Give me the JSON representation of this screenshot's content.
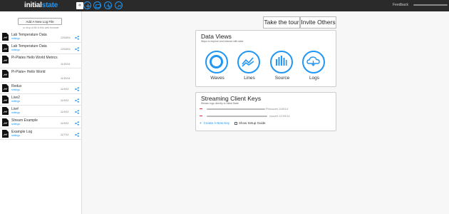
{
  "brand": {
    "initial": "initial",
    "state": "state"
  },
  "topbar": {
    "collapse_glyph": "«",
    "icons": [
      "plus-icon",
      "dashboard-icon",
      "waveform-icon",
      "tile-icon"
    ],
    "feedback_label": "Feedback"
  },
  "sidebar": {
    "add_button": "Add A New Log File",
    "drop_hint": "or drop a file in this web browser",
    "items": [
      {
        "name": "Lab Temperature Data",
        "settings": "settings",
        "date": "12/18/14"
      },
      {
        "name": "Lab Temperature Data",
        "settings": "settings",
        "date": "12/18/14"
      },
      {
        "name": "Pi-Plates Hello World Metrics",
        "settings": "",
        "date": "11/20/14"
      },
      {
        "name": "Pi-Plate+ Hello World",
        "settings": "",
        "date": "11/20/14"
      },
      {
        "name": "Redux",
        "settings": "settings",
        "date": "11/9/14"
      },
      {
        "name": "Live2",
        "settings": "settings",
        "date": "11/9/14"
      },
      {
        "name": "Live!",
        "settings": "settings",
        "date": "11/9/14"
      },
      {
        "name": "Stream Example",
        "settings": "settings",
        "date": "11/9/14"
      },
      {
        "name": "Example Log",
        "settings": "settings",
        "date": "11/7/14"
      }
    ]
  },
  "header": {
    "tour_button": "Take the tour",
    "invite_button": "Invite Others"
  },
  "data_views": {
    "title": "Data Views",
    "subtitle": "Ways to explore and interact with data",
    "items": [
      {
        "label": "Waves",
        "icon": "waves-icon"
      },
      {
        "label": "Lines",
        "icon": "lines-icon"
      },
      {
        "label": "Source",
        "icon": "source-icon"
      },
      {
        "label": "Logs",
        "icon": "logs-icon"
      }
    ]
  },
  "stream_keys": {
    "title": "Streaming Client Keys",
    "subtitle": "Stream logs directly to Initial State",
    "keys": [
      {
        "suffix": "Fh",
        "issued": "Issued 11/8/14"
      },
      {
        "suffix": "",
        "issued": "Issued 12/18/14"
      }
    ],
    "create_label": "Create A New Key",
    "setup_label": "Show Setup Guide"
  },
  "colors": {
    "accent": "#2196f3",
    "danger": "#d32f2f",
    "topbar": "#2a2a2a"
  }
}
